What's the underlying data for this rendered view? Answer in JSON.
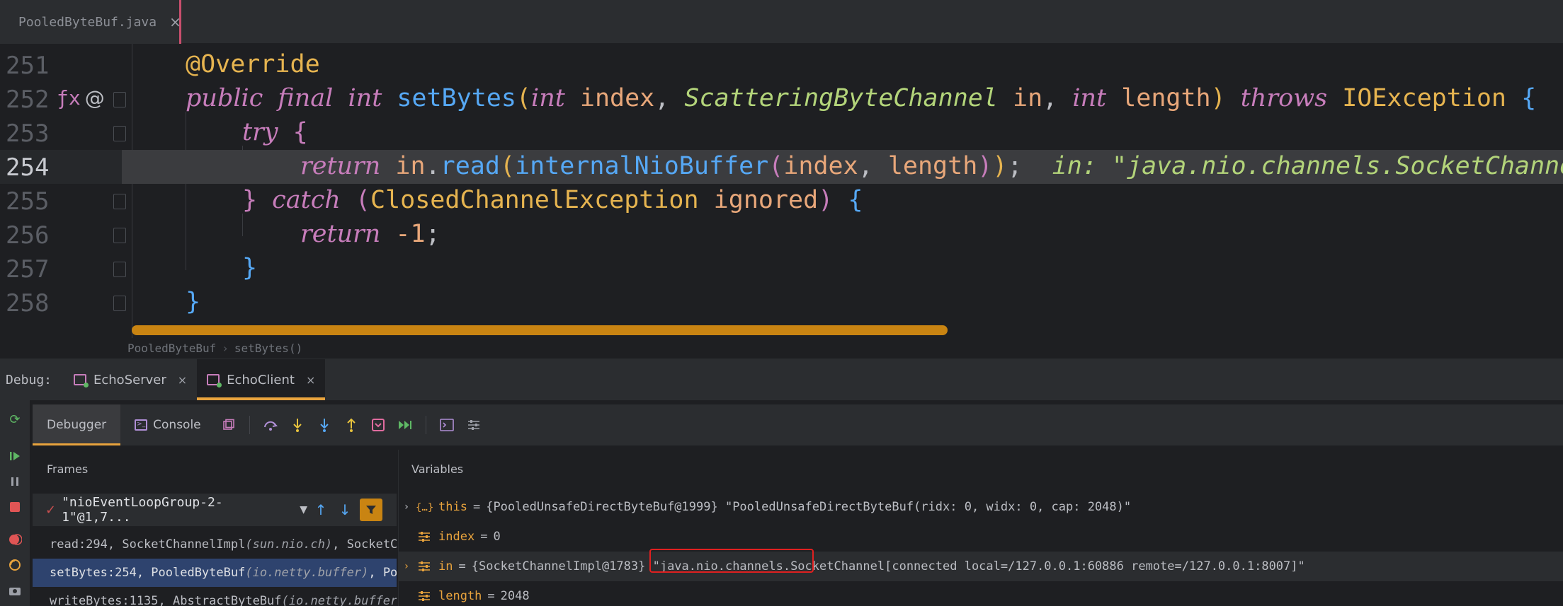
{
  "editor_tab": {
    "filename": "PooledByteBuf.java",
    "close": "×"
  },
  "code_lines": [
    {
      "num": "251"
    },
    {
      "num": "252"
    },
    {
      "num": "253"
    },
    {
      "num": "254"
    },
    {
      "num": "255"
    },
    {
      "num": "256"
    },
    {
      "num": "257"
    },
    {
      "num": "258"
    }
  ],
  "code": {
    "l251_override": "@Override",
    "l252_public": "public",
    "l252_final": "final",
    "l252_int": "int",
    "l252_method": "setBytes",
    "l252_int2": "int",
    "l252_index": "index",
    "l252_comma": ", ",
    "l252_type": "ScatteringByteChannel",
    "l252_in": "in",
    "l252_int3": "int",
    "l252_length": "length",
    "l252_throws": "throws",
    "l252_exc": "IOException",
    "l252_brace": "{",
    "l253_try": "try",
    "l253_brace": "{",
    "l254_return": "return",
    "l254_in": "in",
    "l254_read": "read",
    "l254_nio": "internalNioBuffer",
    "l254_index": "index",
    "l254_length": "length",
    "l254_end": "));",
    "l254_inlay_label": "in:",
    "l254_inlay_value": "\"java.nio.channels.SocketChannel[co",
    "l255_close": "}",
    "l255_catch": "catch",
    "l255_exc": "ClosedChannelException",
    "l255_ignored": "ignored",
    "l255_brace": "{",
    "l256_return": "return",
    "l256_val": "-1",
    "l256_semi": ";",
    "l257_close": "}",
    "l258_close": "}"
  },
  "gutter_icons": {
    "fx": "ƒx",
    "at": "@"
  },
  "breadcrumb": {
    "class_name": "PooledByteBuf",
    "method": "setBytes()",
    "sep": "›"
  },
  "debug": {
    "label": "Debug:",
    "sessions": [
      {
        "label": "EchoServer",
        "close": "×"
      },
      {
        "label": "EchoClient",
        "close": "×"
      }
    ]
  },
  "toolbar": {
    "debugger_tab": "Debugger",
    "console_tab": "Console"
  },
  "frames": {
    "title": "Frames",
    "thread": "\"nioEventLoopGroup-2-1\"@1,7...",
    "items": [
      {
        "method": "read:294, SocketChannelImpl ",
        "pkg": "(sun.nio.ch)",
        "rest": ", SocketC"
      },
      {
        "method": "setBytes:254, PooledByteBuf ",
        "pkg": "(io.netty.buffer)",
        "rest": ", Po"
      },
      {
        "method": "writeBytes:1135, AbstractByteBuf ",
        "pkg": "(io.netty.buffer",
        "rest": ""
      }
    ]
  },
  "variables": {
    "title": "Variables",
    "rows": [
      {
        "name": "this",
        "eq": "=",
        "value": "{PooledUnsafeDirectByteBuf@1999} \"PooledUnsafeDirectByteBuf(ridx: 0, widx: 0, cap: 2048)\""
      },
      {
        "name": "index",
        "eq": "=",
        "value": "0"
      },
      {
        "name": "in",
        "eq": "=",
        "value": "{SocketChannelImpl@1783} \"java.nio.channels.SocketChannel[connected local=/127.0.0.1:60886 remote=/127.0.0.1:8007]\""
      },
      {
        "name": "length",
        "eq": "=",
        "value": "2048"
      }
    ]
  },
  "colors": {
    "accent": "#e8a33d",
    "keyword": "#c77dbb",
    "function": "#56a8f5",
    "type": "#b3d47a",
    "parameter": "#e8a77a",
    "highlight_box": "#e02020"
  }
}
